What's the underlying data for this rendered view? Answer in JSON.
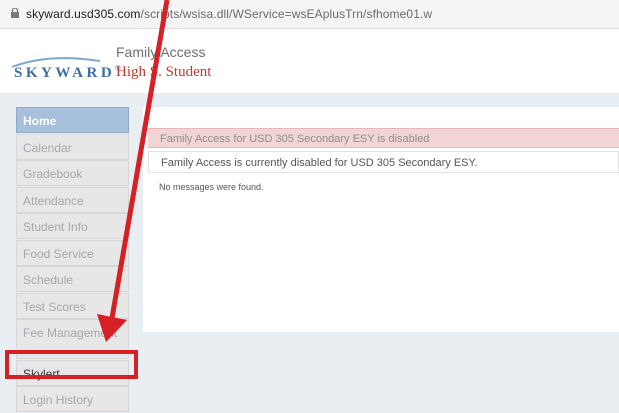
{
  "browser": {
    "url_host": "skyward.usd305.com",
    "url_path": "/scripts/wsisa.dll/WService=wsEAplusTrn/sfhome01.w",
    "icon": "lock-icon"
  },
  "header": {
    "logo_text": "SKYWARD",
    "logo_mark": "®",
    "app_title": "Family Access",
    "user_name": "High S. Student"
  },
  "sidebar": {
    "items": [
      {
        "label": "Home"
      },
      {
        "label": "Calendar"
      },
      {
        "label": "Gradebook"
      },
      {
        "label": "Attendance"
      },
      {
        "label": "Student Info"
      },
      {
        "label": "Food Service"
      },
      {
        "label": "Schedule"
      },
      {
        "label": "Test Scores"
      },
      {
        "label": "Fee Management"
      },
      {
        "label": "Skylert"
      },
      {
        "label": "Login History"
      }
    ]
  },
  "main": {
    "alert_title": "Family Access for USD 305 Secondary ESY is disabled",
    "alert_message": "Family Access is currently disabled for USD 305 Secondary ESY.",
    "empty_messages": "No messages were found."
  },
  "colors": {
    "annotation": "#d62025",
    "active_nav": "#a6bfda",
    "alert_bg": "#f2d4d4"
  }
}
